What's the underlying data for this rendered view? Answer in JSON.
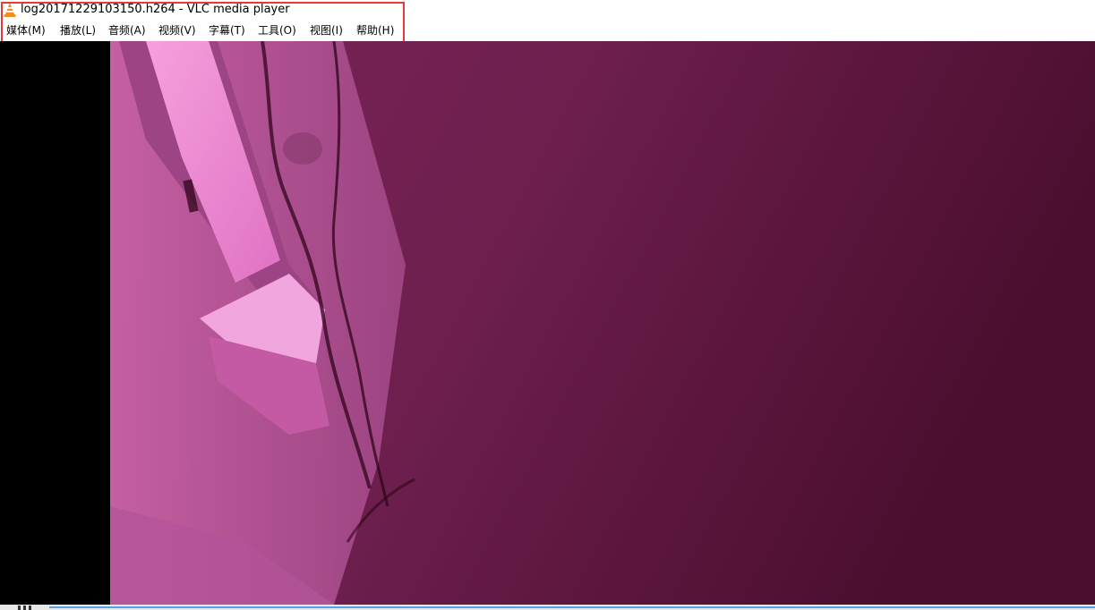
{
  "window": {
    "title": "log20171229103150.h264 - VLC media player",
    "app_icon": "vlc-cone-icon"
  },
  "menu": {
    "items": [
      {
        "label": "媒体(M)"
      },
      {
        "label": "播放(L)"
      },
      {
        "label": "音频(A)"
      },
      {
        "label": "视频(V)"
      },
      {
        "label": "字幕(T)"
      },
      {
        "label": "工具(O)"
      },
      {
        "label": "视图(I)"
      },
      {
        "label": "帮助(H)"
      }
    ]
  },
  "colors": {
    "highlight_box": "#e8393a",
    "video_tint": "#6b1f4a",
    "window_light": "#f08ad0"
  },
  "controls": {
    "pause_icon": "pause-icon"
  }
}
